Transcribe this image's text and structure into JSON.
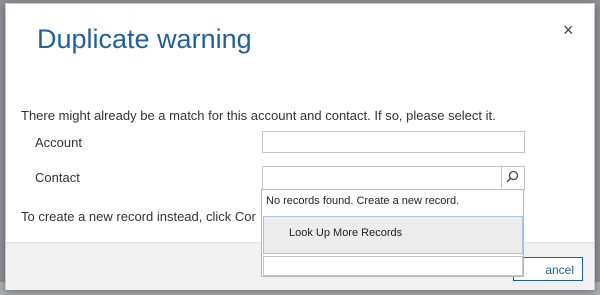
{
  "dialog": {
    "title": "Duplicate warning",
    "close_glyph": "×",
    "message": "There might already be a match for this account and contact. If so, please select it.",
    "fields": {
      "account": {
        "label": "Account",
        "value": ""
      },
      "contact": {
        "label": "Contact",
        "value": ""
      }
    },
    "lookup_icon": "search-icon",
    "create_text": "To create a new record instead, click Cor",
    "dropdown": {
      "no_records": "No records found. Create a new record.",
      "look_up_more": "Look Up More Records",
      "input_value": ""
    },
    "footer": {
      "cancel_label": "ancel"
    }
  },
  "colors": {
    "title": "#1f5f9e",
    "accent": "#1f5f9e",
    "footer_bg": "#f1f1f1",
    "overlay": "#8d9196"
  }
}
